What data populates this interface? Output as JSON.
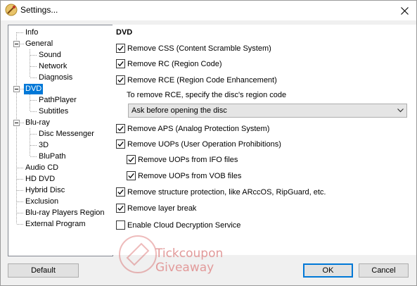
{
  "window": {
    "title": "Settings..."
  },
  "tree": {
    "items": [
      {
        "label": "Info"
      },
      {
        "label": "General"
      },
      {
        "label": "Sound"
      },
      {
        "label": "Network"
      },
      {
        "label": "Diagnosis"
      },
      {
        "label": "DVD"
      },
      {
        "label": "PathPlayer"
      },
      {
        "label": "Subtitles"
      },
      {
        "label": "Blu-ray"
      },
      {
        "label": "Disc Messenger"
      },
      {
        "label": "3D"
      },
      {
        "label": "BluPath"
      },
      {
        "label": "Audio CD"
      },
      {
        "label": "HD DVD"
      },
      {
        "label": "Hybrid Disc"
      },
      {
        "label": "Exclusion"
      },
      {
        "label": "Blu-ray Players Region"
      },
      {
        "label": "External Program"
      }
    ],
    "selected": "DVD"
  },
  "dvd": {
    "section_title": "DVD",
    "options": [
      {
        "label": "Remove CSS (Content Scramble System)",
        "checked": true
      },
      {
        "label": "Remove RC (Region Code)",
        "checked": true
      },
      {
        "label": "Remove RCE (Region Code Enhancement)",
        "checked": true
      },
      {
        "label": "Remove APS (Analog Protection System)",
        "checked": true
      },
      {
        "label": "Remove UOPs (User Operation Prohibitions)",
        "checked": true
      },
      {
        "label": "Remove UOPs from IFO files",
        "checked": true
      },
      {
        "label": "Remove UOPs from VOB files",
        "checked": true
      },
      {
        "label": "Remove structure protection, like ARccOS, RipGuard, etc.",
        "checked": true
      },
      {
        "label": "Remove layer break",
        "checked": true
      },
      {
        "label": "Enable Cloud Decryption Service",
        "checked": false
      }
    ],
    "rce_hint": "To remove RCE, specify the disc's region code",
    "region_select": {
      "value": "Ask before opening the disc"
    }
  },
  "watermark": {
    "line1": "Tickcoupon",
    "line2": "Giveaway"
  },
  "buttons": {
    "default": "Default",
    "ok": "OK",
    "cancel": "Cancel"
  },
  "colors": {
    "selection": "#0078d7",
    "dialog_bg": "#f0f0f0"
  }
}
